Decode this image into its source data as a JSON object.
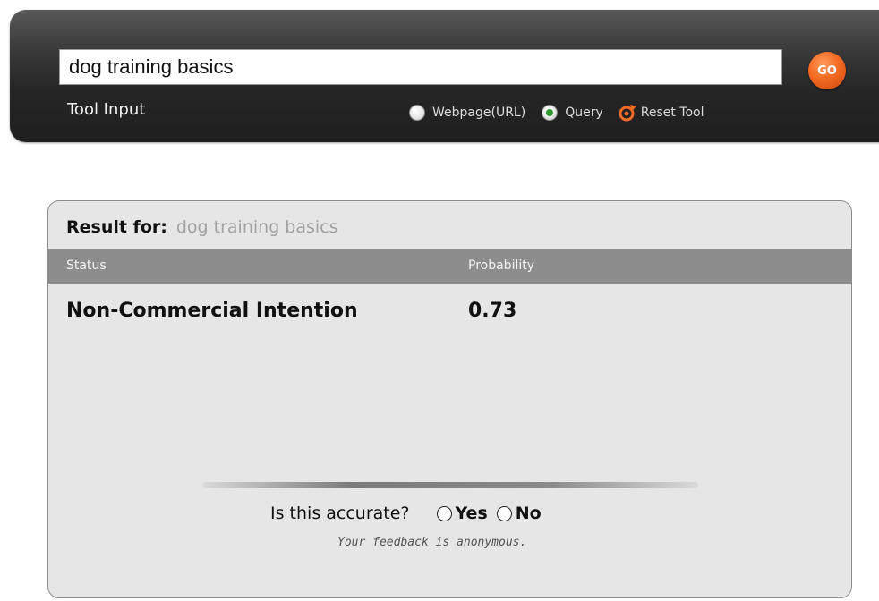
{
  "tool": {
    "query_value": "dog training basics",
    "go_label": "GO",
    "input_label": "Tool Input",
    "options": [
      {
        "label": "Webpage(URL)",
        "selected": false
      },
      {
        "label": "Query",
        "selected": true
      }
    ],
    "reset_label": "Reset Tool"
  },
  "result": {
    "for_label": "Result for:",
    "for_value": "dog training basics",
    "columns": [
      "Status",
      "Probability"
    ],
    "status": "Non-Commercial Intention",
    "probability": "0.73"
  },
  "feedback": {
    "question": "Is this accurate?",
    "yes_label": "Yes",
    "no_label": "No",
    "note": "Your feedback is anonymous."
  },
  "colors": {
    "toolbar_dark": "#262626",
    "go_orange": "#f36a22",
    "result_bg": "#e6e6e6",
    "header_gray": "#8d8d8d",
    "selected_green": "#2f9a2f"
  }
}
